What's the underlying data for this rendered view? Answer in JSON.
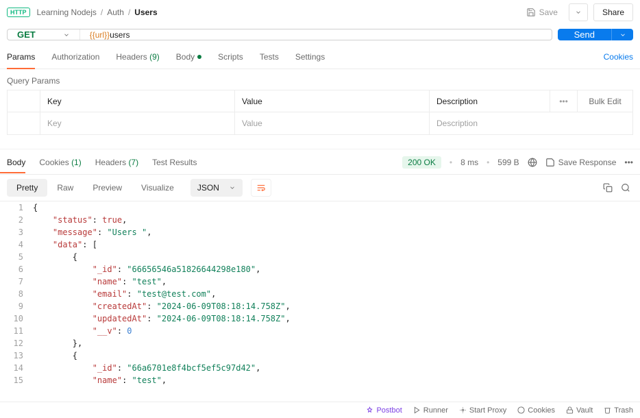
{
  "breadcrumb": {
    "root": "Learning Nodejs",
    "folder": "Auth",
    "current": "Users"
  },
  "topbar": {
    "save": "Save",
    "share": "Share"
  },
  "request": {
    "method": "GET",
    "url_var": "{{url}}",
    "url_rest": " users",
    "send": "Send",
    "tabs": {
      "params": "Params",
      "auth": "Authorization",
      "headers": "Headers",
      "headers_count": "(9)",
      "body": "Body",
      "scripts": "Scripts",
      "tests": "Tests",
      "settings": "Settings",
      "cookies_link": "Cookies"
    }
  },
  "queryParams": {
    "title": "Query Params",
    "headers": {
      "key": "Key",
      "value": "Value",
      "desc": "Description",
      "more": "•••",
      "bulk": "Bulk Edit"
    },
    "placeholders": {
      "key": "Key",
      "value": "Value",
      "desc": "Description"
    }
  },
  "response": {
    "tabs": {
      "body": "Body",
      "cookies": "Cookies",
      "cookies_count": "(1)",
      "headers": "Headers",
      "headers_count": "(7)",
      "tests": "Test Results"
    },
    "status": "200 OK",
    "time": "8 ms",
    "size": "599 B",
    "save_response": "Save Response"
  },
  "viewer": {
    "pretty": "Pretty",
    "raw": "Raw",
    "preview": "Preview",
    "visualize": "Visualize",
    "format": "JSON"
  },
  "code": {
    "lines": [
      {
        "n": 1,
        "indent": 0,
        "raw": "{"
      },
      {
        "n": 2,
        "indent": 1,
        "key": "status",
        "bool": "true",
        "comma": true
      },
      {
        "n": 3,
        "indent": 1,
        "key": "message",
        "str": "Users ",
        "comma": true
      },
      {
        "n": 4,
        "indent": 1,
        "key": "data",
        "raw_after": ": ["
      },
      {
        "n": 5,
        "indent": 2,
        "raw": "{"
      },
      {
        "n": 6,
        "indent": 3,
        "key": "_id",
        "str": "66656546a51826644298e180",
        "comma": true
      },
      {
        "n": 7,
        "indent": 3,
        "key": "name",
        "str": "test",
        "comma": true
      },
      {
        "n": 8,
        "indent": 3,
        "key": "email",
        "str": "test@test.com",
        "comma": true
      },
      {
        "n": 9,
        "indent": 3,
        "key": "createdAt",
        "str": "2024-06-09T08:18:14.758Z",
        "comma": true
      },
      {
        "n": 10,
        "indent": 3,
        "key": "updatedAt",
        "str": "2024-06-09T08:18:14.758Z",
        "comma": true
      },
      {
        "n": 11,
        "indent": 3,
        "key": "__v",
        "num": "0"
      },
      {
        "n": 12,
        "indent": 2,
        "raw": "},"
      },
      {
        "n": 13,
        "indent": 2,
        "raw": "{"
      },
      {
        "n": 14,
        "indent": 3,
        "key": "_id",
        "str": "66a6701e8f4bcf5ef5c97d42",
        "comma": true
      },
      {
        "n": 15,
        "indent": 3,
        "key": "name",
        "str": "test",
        "comma": true
      }
    ]
  },
  "footer": {
    "postbot": "Postbot",
    "runner": "Runner",
    "proxy": "Start Proxy",
    "cookies": "Cookies",
    "vault": "Vault",
    "trash": "Trash"
  }
}
